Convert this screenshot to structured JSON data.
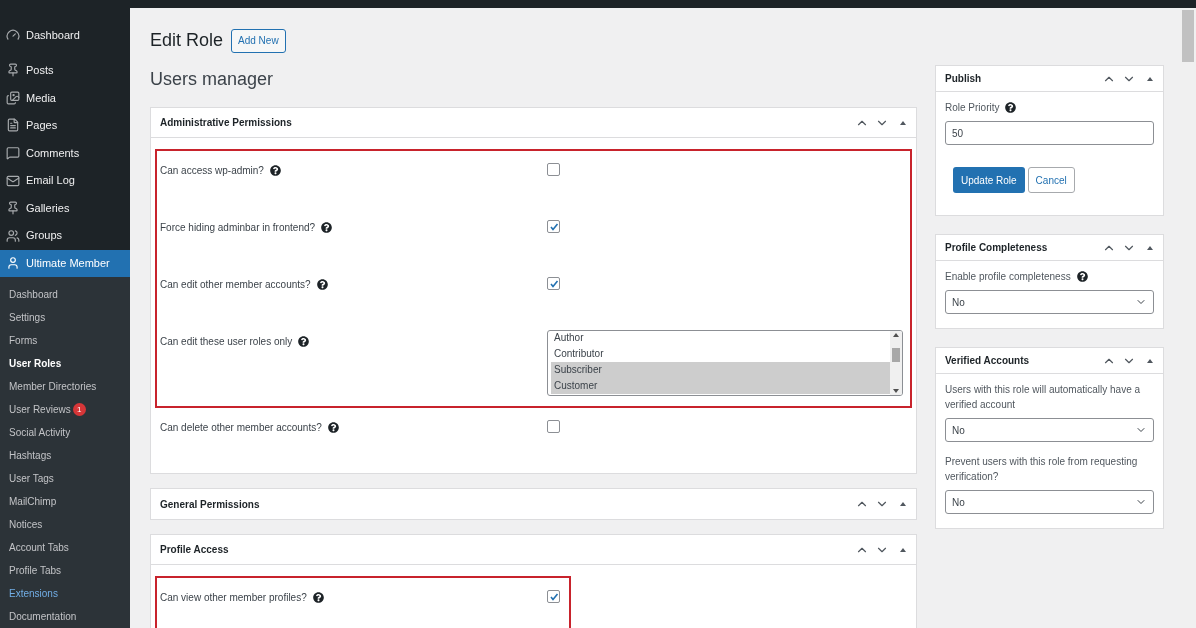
{
  "sidebar": {
    "items": [
      {
        "label": "Dashboard",
        "selected": false
      },
      {
        "label": "Posts",
        "selected": false
      },
      {
        "label": "Media",
        "selected": false
      },
      {
        "label": "Pages",
        "selected": false
      },
      {
        "label": "Comments",
        "selected": false
      },
      {
        "label": "Email Log",
        "selected": false
      },
      {
        "label": "Galleries",
        "selected": false
      },
      {
        "label": "Groups",
        "selected": false
      },
      {
        "label": "Ultimate Member",
        "selected": true
      }
    ],
    "submenu": [
      {
        "label": "Dashboard",
        "selected": false
      },
      {
        "label": "Settings",
        "selected": false
      },
      {
        "label": "Forms",
        "selected": false
      },
      {
        "label": "User Roles",
        "selected": true
      },
      {
        "label": "Member Directories",
        "selected": false
      },
      {
        "label": "User Reviews",
        "selected": false,
        "badge": "1"
      },
      {
        "label": "Social Activity",
        "selected": false
      },
      {
        "label": "Hashtags",
        "selected": false
      },
      {
        "label": "User Tags",
        "selected": false
      },
      {
        "label": "MailChimp",
        "selected": false
      },
      {
        "label": "Notices",
        "selected": false
      },
      {
        "label": "Account Tabs",
        "selected": false
      },
      {
        "label": "Profile Tabs",
        "selected": false
      },
      {
        "label": "Extensions",
        "selected": false,
        "highlight": true
      },
      {
        "label": "Documentation",
        "selected": false
      }
    ]
  },
  "page": {
    "title": "Edit Role",
    "add_new": "Add New",
    "subtitle": "Users manager"
  },
  "sections": [
    {
      "title": "Administrative Permissions",
      "groups": [
        {
          "highlighted": true,
          "fields": [
            {
              "kind": "checkbox",
              "label": "Can access wp-admin?",
              "checked": false
            },
            {
              "kind": "checkbox",
              "label": "Force hiding adminbar in frontend?",
              "checked": true
            },
            {
              "kind": "checkbox",
              "label": "Can edit other member accounts?",
              "checked": true
            },
            {
              "kind": "listbox",
              "label": "Can edit these user roles only",
              "options": [
                {
                  "label": "Author",
                  "selected": false
                },
                {
                  "label": "Contributor",
                  "selected": false
                },
                {
                  "label": "Subscriber",
                  "selected": true
                },
                {
                  "label": "Customer",
                  "selected": true
                }
              ]
            }
          ]
        },
        {
          "highlighted": false,
          "fields": [
            {
              "kind": "checkbox",
              "label": "Can delete other member accounts?",
              "checked": false
            }
          ]
        }
      ]
    },
    {
      "title": "General Permissions"
    },
    {
      "title": "Profile Access",
      "groups": [
        {
          "highlighted": true,
          "fields": [
            {
              "kind": "checkbox",
              "label": "Can view other member profiles?",
              "checked": true
            }
          ]
        }
      ]
    }
  ],
  "side_boxes": [
    {
      "title": "Publish",
      "items": [
        {
          "kind": "input",
          "label": "Role Priority",
          "value": "50"
        },
        {
          "kind": "buttons",
          "primary": "Update Role",
          "secondary": "Cancel"
        }
      ]
    },
    {
      "title": "Profile Completeness",
      "items": [
        {
          "kind": "select",
          "label": "Enable profile completeness",
          "value": "No",
          "help": true
        }
      ]
    },
    {
      "title": "Verified Accounts",
      "items": [
        {
          "kind": "select",
          "label": "Users with this role will automatically have a verified account",
          "value": "No",
          "help": false
        },
        {
          "kind": "select",
          "label": "Prevent users with this role from requesting verification?",
          "value": "No",
          "help": false
        }
      ]
    }
  ]
}
